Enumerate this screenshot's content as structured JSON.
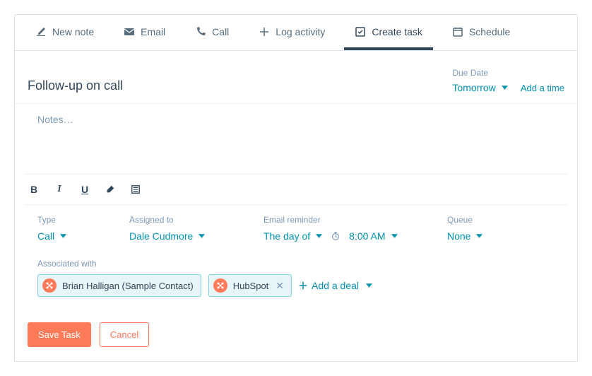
{
  "tabs": {
    "new_note": "New note",
    "email": "Email",
    "call": "Call",
    "log_activity": "Log activity",
    "create_task": "Create task",
    "schedule": "Schedule"
  },
  "task": {
    "title": "Follow-up on call",
    "notes_placeholder": "Notes…",
    "due_date_label": "Due Date",
    "due_date_value": "Tomorrow",
    "add_time_label": "Add a time"
  },
  "fields": {
    "type_label": "Type",
    "type_value": "Call",
    "assigned_label": "Assigned to",
    "assigned_value": "Dale Cudmore",
    "reminder_label": "Email reminder",
    "reminder_day": "The day of",
    "reminder_time": "8:00 AM",
    "queue_label": "Queue",
    "queue_value": "None"
  },
  "associated": {
    "label": "Associated with",
    "contacts": [
      {
        "name": "Brian Halligan (Sample Contact)"
      },
      {
        "name": "HubSpot"
      }
    ],
    "add_deal": "Add a deal"
  },
  "buttons": {
    "save": "Save Task",
    "cancel": "Cancel"
  }
}
